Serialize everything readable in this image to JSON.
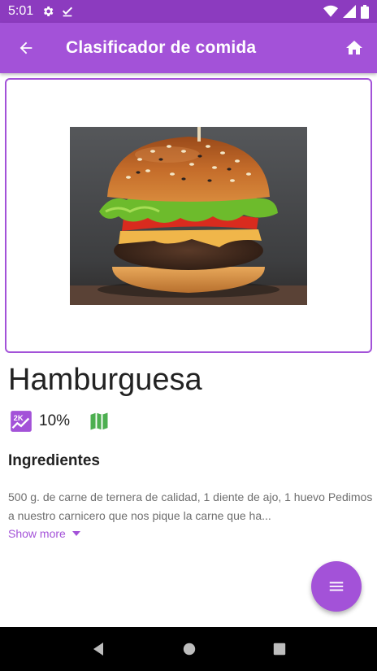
{
  "status_bar": {
    "time": "5:01"
  },
  "app_bar": {
    "title": "Clasificador de comida"
  },
  "food": {
    "name": "Hamburguesa",
    "percent": "10%"
  },
  "ingredients": {
    "title": "Ingredientes",
    "text": "500 g. de carne de ternera de calidad, 1 diente de ajo, 1 huevo Pedimos a nuestro carnicero que nos pique la carne que ha...",
    "show_more": "Show more"
  },
  "icons": {
    "status": [
      "gear-icon",
      "check-icon",
      "wifi-icon",
      "signal-icon",
      "battery-icon"
    ],
    "app_bar": [
      "arrow-back-icon",
      "home-icon"
    ],
    "meta": [
      "kcal-icon",
      "map-icon"
    ],
    "fab": "menu-icon",
    "nav": [
      "nav-back-icon",
      "nav-home-icon",
      "nav-recents-icon"
    ]
  },
  "colors": {
    "primary": "#a352d8",
    "status_bar": "#8c3bbf",
    "kcal": "#a352d8",
    "map": "#4caf50"
  }
}
